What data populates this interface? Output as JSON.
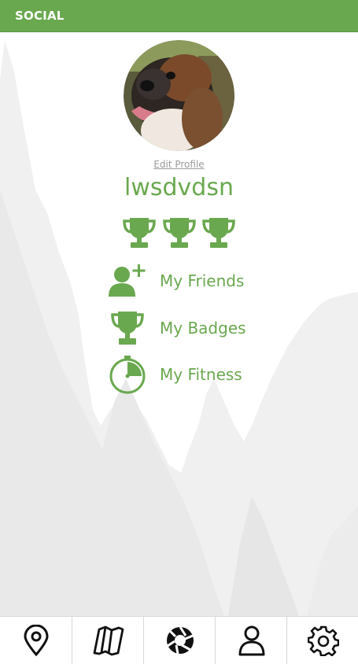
{
  "header": {
    "title": "SOCIAL"
  },
  "profile": {
    "edit_label": "Edit Profile",
    "username": "lwsdvdsn",
    "trophies": [
      "trophy",
      "trophy",
      "trophy"
    ]
  },
  "menu": [
    {
      "label": "My Friends",
      "icon": "add-friend-icon"
    },
    {
      "label": "My Badges",
      "icon": "trophy-icon"
    },
    {
      "label": "My Fitness",
      "icon": "stopwatch-icon"
    }
  ],
  "tabbar": {
    "tabs": [
      {
        "icon": "location-pin-icon"
      },
      {
        "icon": "map-icon"
      },
      {
        "icon": "aperture-icon"
      },
      {
        "icon": "profile-icon"
      },
      {
        "icon": "settings-gear-icon"
      }
    ]
  },
  "colors": {
    "accent": "#6aa84f",
    "header": "#6aa84f",
    "muted": "#9a9a9a",
    "mountain": "#eeeeee"
  }
}
